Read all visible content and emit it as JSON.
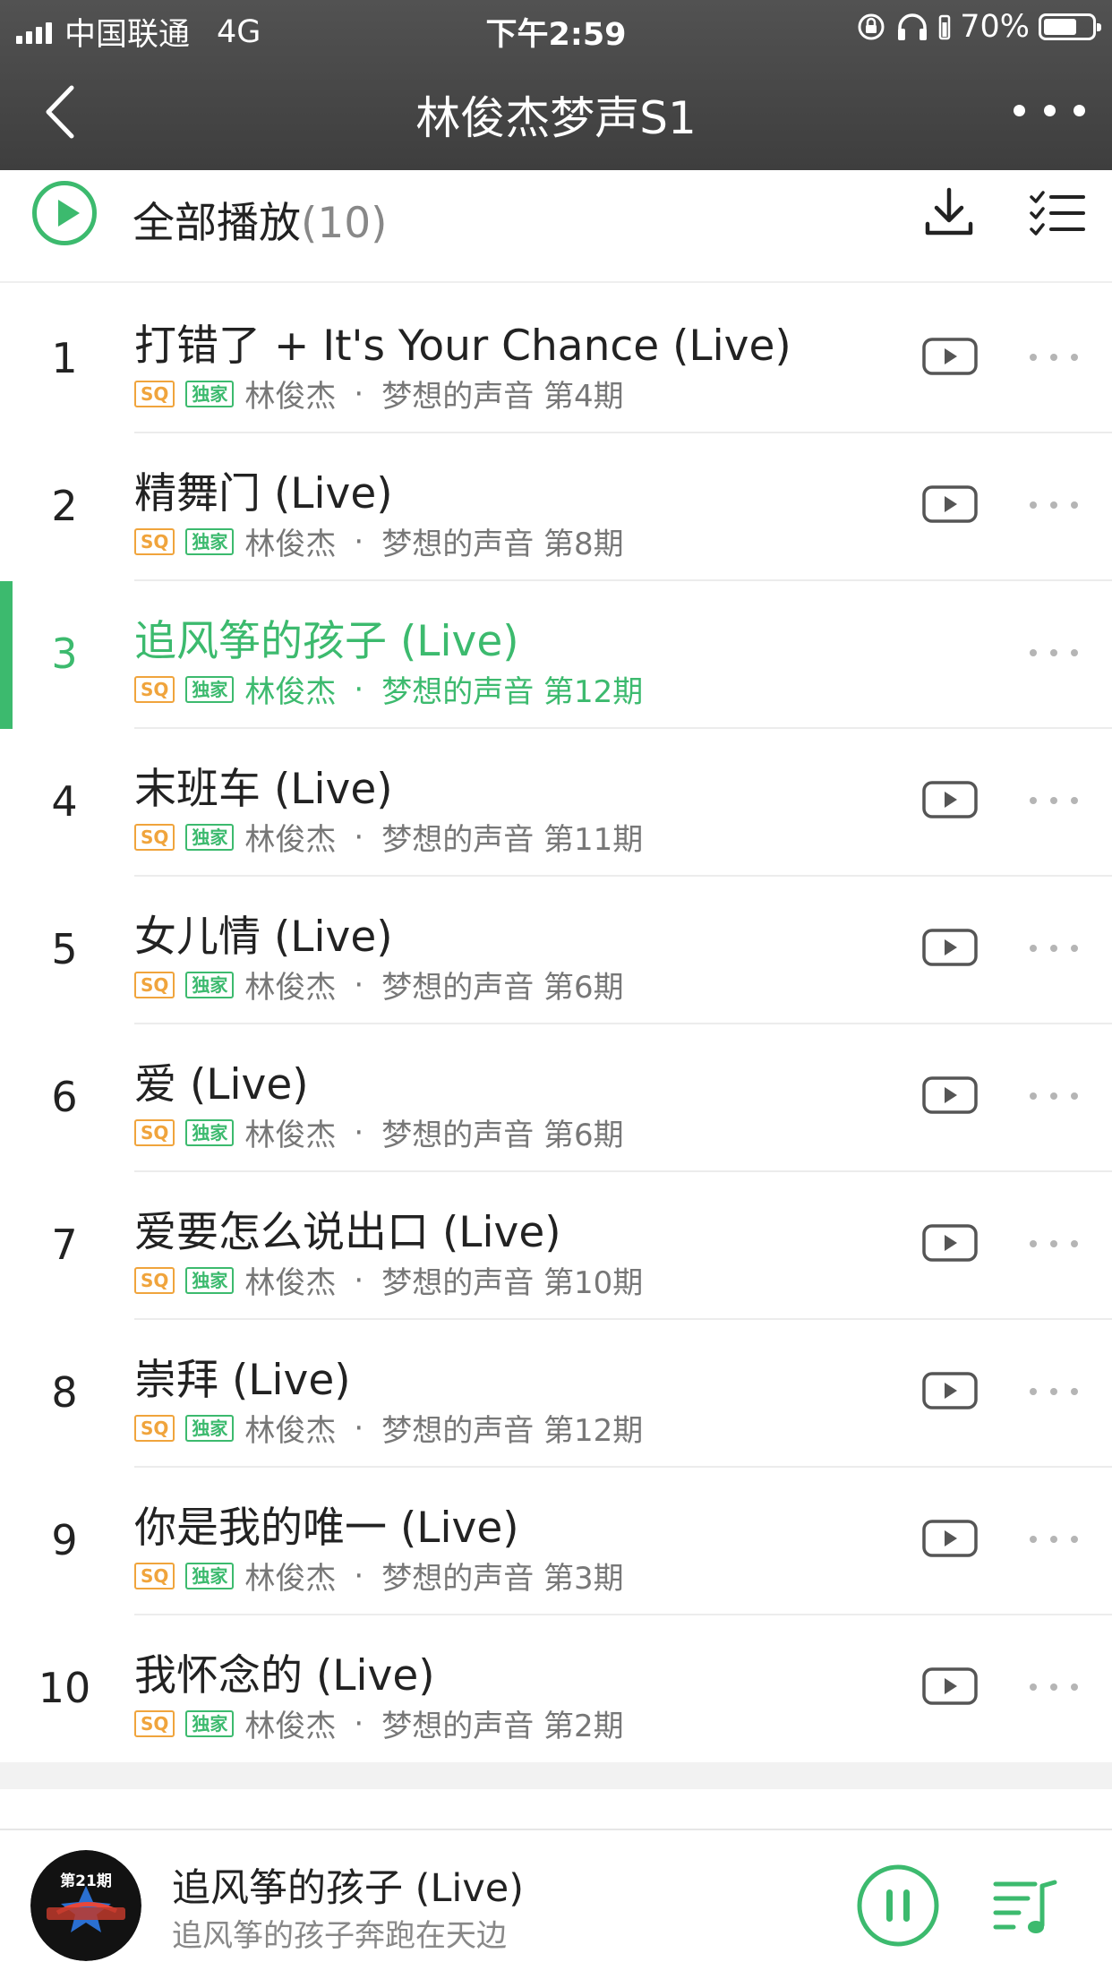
{
  "status_bar": {
    "carrier": "中国联通",
    "network": "4G",
    "time": "下午2:59",
    "battery_percent": "70%",
    "battery_level": 0.7
  },
  "nav": {
    "title": "林俊杰梦声S1",
    "icons": {
      "back": "chevron-left-icon",
      "more": "more-dots-icon"
    }
  },
  "play_all": {
    "label": "全部播放",
    "count": "(10)",
    "icons": {
      "play": "play-circle-icon",
      "download": "download-icon",
      "multiselect": "list-select-icon"
    }
  },
  "badges": {
    "sq": "SQ",
    "exclusive": "独家"
  },
  "colors": {
    "accent": "#3cba6e",
    "sq": "#f0a43c",
    "header": "#474747"
  },
  "songs": [
    {
      "index": "1",
      "title": "打错了 + It's Your Chance (Live)",
      "artist": "林俊杰",
      "separator": "·",
      "album": "梦想的声音 第4期"
    },
    {
      "index": "2",
      "title": "精舞门 (Live)",
      "artist": "林俊杰",
      "separator": "·",
      "album": "梦想的声音 第8期"
    },
    {
      "index": "3",
      "title": "追风筝的孩子 (Live)",
      "artist": "林俊杰",
      "separator": "·",
      "album": "梦想的声音 第12期",
      "playing": true
    },
    {
      "index": "4",
      "title": "末班车 (Live)",
      "artist": "林俊杰",
      "separator": "·",
      "album": "梦想的声音 第11期"
    },
    {
      "index": "5",
      "title": "女儿情 (Live)",
      "artist": "林俊杰",
      "separator": "·",
      "album": "梦想的声音 第6期"
    },
    {
      "index": "6",
      "title": "爱 (Live)",
      "artist": "林俊杰",
      "separator": "·",
      "album": "梦想的声音 第6期"
    },
    {
      "index": "7",
      "title": "爱要怎么说出口 (Live)",
      "artist": "林俊杰",
      "separator": "·",
      "album": "梦想的声音 第10期"
    },
    {
      "index": "8",
      "title": "崇拜 (Live)",
      "artist": "林俊杰",
      "separator": "·",
      "album": "梦想的声音 第12期"
    },
    {
      "index": "9",
      "title": "你是我的唯一 (Live)",
      "artist": "林俊杰",
      "separator": "·",
      "album": "梦想的声音 第3期"
    },
    {
      "index": "10",
      "title": "我怀念的 (Live)",
      "artist": "林俊杰",
      "separator": "·",
      "album": "梦想的声音 第2期"
    }
  ],
  "mini_player": {
    "album_art_text": "第21期",
    "title": "追风筝的孩子 (Live)",
    "subtitle": "追风筝的孩子奔跑在天边",
    "icons": {
      "pause": "pause-circle-icon",
      "playlist": "playlist-icon"
    }
  }
}
